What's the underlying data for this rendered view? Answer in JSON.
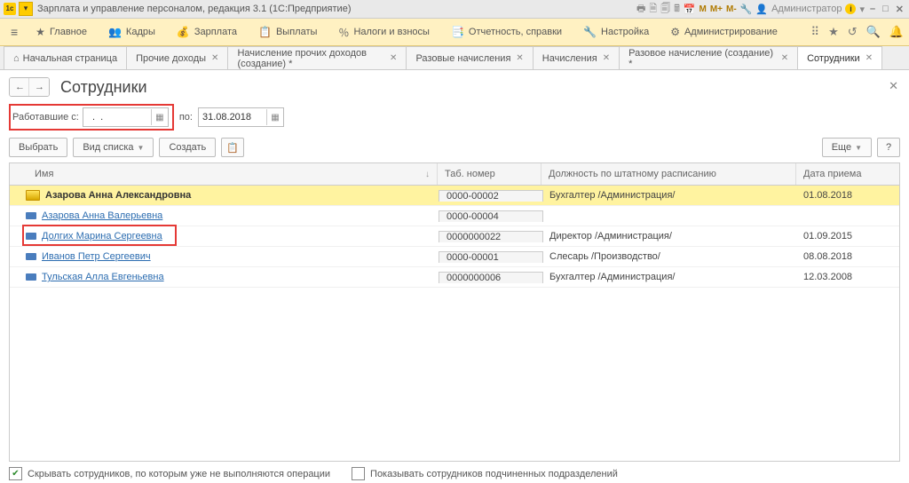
{
  "window": {
    "title": "Зарплата и управление персоналом, редакция 3.1  (1С:Предприятие)",
    "user": "Администратор"
  },
  "mainmenu": [
    {
      "icon": "★",
      "label": "Главное"
    },
    {
      "icon": "👥",
      "label": "Кадры"
    },
    {
      "icon": "💰",
      "label": "Зарплата"
    },
    {
      "icon": "📋",
      "label": "Выплаты"
    },
    {
      "icon": "％",
      "label": "Налоги и взносы"
    },
    {
      "icon": "📑",
      "label": "Отчетность, справки"
    },
    {
      "icon": "🔧",
      "label": "Настройка"
    },
    {
      "icon": "⚙",
      "label": "Администрирование"
    }
  ],
  "tabs": [
    {
      "label": "Начальная страница",
      "home": true
    },
    {
      "label": "Прочие доходы",
      "close": true
    },
    {
      "label": "Начисление прочих доходов (создание) *",
      "close": true
    },
    {
      "label": "Разовые начисления",
      "close": true
    },
    {
      "label": "Начисления",
      "close": true
    },
    {
      "label": "Разовое начисление (создание) *",
      "close": true
    },
    {
      "label": "Сотрудники",
      "close": true,
      "active": true
    }
  ],
  "page": {
    "title": "Сотрудники",
    "filter_label": "Работавшие с:",
    "filter_from": "  .  .    ",
    "filter_sep": "по:",
    "filter_to": "31.08.2018"
  },
  "buttons": {
    "select": "Выбрать",
    "viewtype": "Вид списка",
    "create": "Создать",
    "more": "Еще",
    "help": "?"
  },
  "columns": {
    "name": "Имя",
    "tab": "Таб. номер",
    "pos": "Должность по штатному расписанию",
    "date": "Дата приема"
  },
  "rows": [
    {
      "name": "Азарова Анна Александровна",
      "tab": "0000-00002",
      "pos": "Бухгалтер /Администрация/",
      "date": "01.08.2018",
      "selected": true
    },
    {
      "name": "Азарова Анна Валерьевна",
      "tab": "0000-00004",
      "pos": "",
      "date": ""
    },
    {
      "name": "Долгих Марина Сергеевна",
      "tab": "0000000022",
      "pos": "Директор /Администрация/",
      "date": "01.09.2015"
    },
    {
      "name": "Иванов Петр Сергеевич",
      "tab": "0000-00001",
      "pos": "Слесарь /Производство/",
      "date": "08.08.2018"
    },
    {
      "name": "Тульская Алла Евгеньевна",
      "tab": "0000000006",
      "pos": "Бухгалтер /Администрация/",
      "date": "12.03.2008"
    }
  ],
  "footer": {
    "hide": "Скрывать сотрудников, по которым уже не выполняются операции",
    "show": "Показывать сотрудников подчиненных подразделений"
  }
}
